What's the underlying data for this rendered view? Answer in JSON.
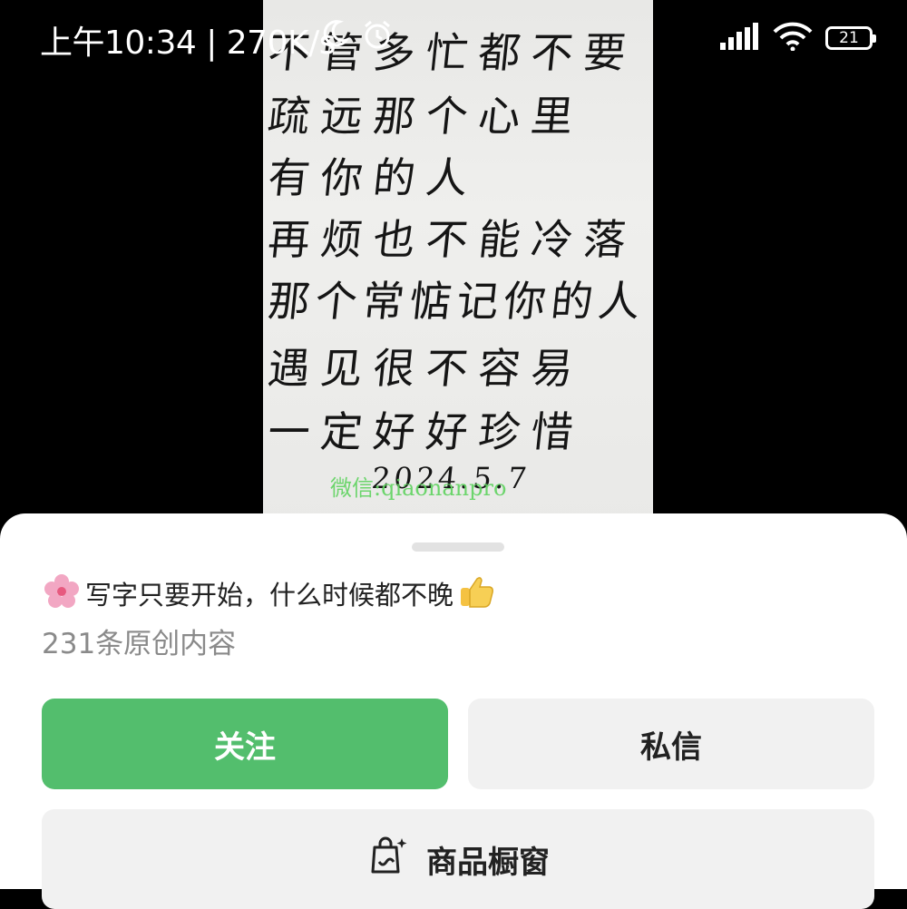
{
  "status_bar": {
    "time": "上午10:34 | 270K/s",
    "battery": "21",
    "icons": [
      "moon-icon",
      "alarm-icon",
      "signal-icon",
      "wifi-icon",
      "battery-icon"
    ]
  },
  "video": {
    "handwriting_lines": [
      "不管多忙都不要",
      "疏远那个心里",
      "有你的人",
      "再烦也不能冷落",
      "那个常惦记你的人",
      "遇见很不容易",
      "一定好好珍惜"
    ],
    "date": "2024.5.7",
    "watermark": "微信:qiaonanpro"
  },
  "profile": {
    "bio": "写字只要开始，什么时候都不晚",
    "bio_emojis": [
      "flower-emoji",
      "thumbs-up-emoji"
    ],
    "content_count": "231条原创内容"
  },
  "actions": {
    "follow_label": "关注",
    "message_label": "私信",
    "showcase_label": "商品橱窗"
  },
  "colors": {
    "follow_bg": "#53be6d",
    "secondary_bg": "#f1f1f1",
    "sheet_bg": "#ffffff",
    "muted_text": "#8a8a8a"
  }
}
